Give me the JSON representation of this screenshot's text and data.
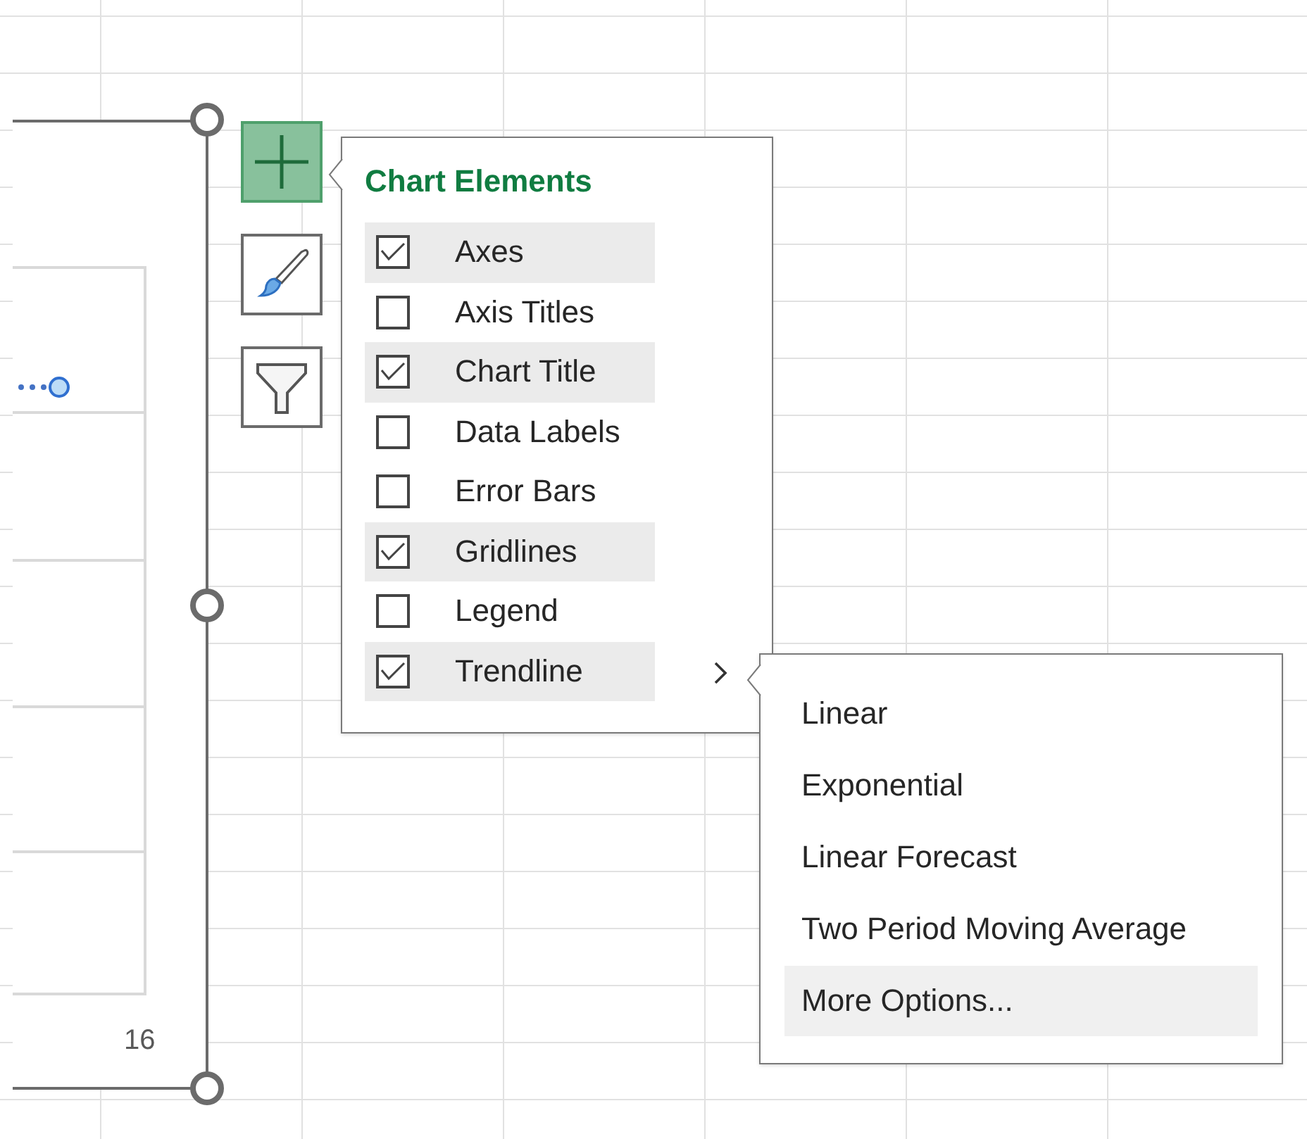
{
  "chart": {
    "axis_label": "16"
  },
  "chart_buttons": [
    {
      "kind": "plus",
      "selected": true
    },
    {
      "kind": "brush",
      "selected": false
    },
    {
      "kind": "filter",
      "selected": false
    }
  ],
  "chart_elements": {
    "title": "Chart Elements",
    "items": [
      {
        "label": "Axes",
        "checked": true,
        "kind": "plain"
      },
      {
        "label": "Axis Titles",
        "checked": false,
        "kind": "plain"
      },
      {
        "label": "Chart Title",
        "checked": true,
        "kind": "plain"
      },
      {
        "label": "Data Labels",
        "checked": false,
        "kind": "plain"
      },
      {
        "label": "Error Bars",
        "checked": false,
        "kind": "plain"
      },
      {
        "label": "Gridlines",
        "checked": true,
        "kind": "plain"
      },
      {
        "label": "Legend",
        "checked": false,
        "kind": "plain"
      },
      {
        "label": "Trendline",
        "checked": true,
        "kind": "submenu"
      }
    ]
  },
  "trendline_menu": [
    {
      "label": "Linear",
      "selected": false
    },
    {
      "label": "Exponential",
      "selected": false
    },
    {
      "label": "Linear Forecast",
      "selected": false
    },
    {
      "label": "Two Period Moving Average",
      "selected": false
    },
    {
      "label": "More Options...",
      "selected": true
    }
  ]
}
